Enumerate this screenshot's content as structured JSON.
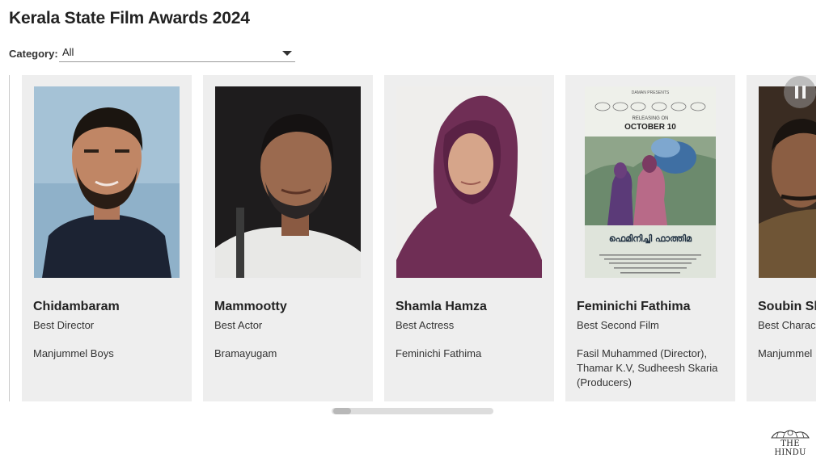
{
  "page": {
    "title": "Kerala State Film Awards 2024"
  },
  "filter": {
    "label": "Category:",
    "selected": "All"
  },
  "awards": [
    {
      "name": "Chidambaram",
      "award": "Best Director",
      "film": "Manjummel Boys"
    },
    {
      "name": "Mammootty",
      "award": "Best Actor",
      "film": "Bramayugam"
    },
    {
      "name": "Shamla Hamza",
      "award": "Best Actress",
      "film": "Feminichi Fathima"
    },
    {
      "name": "Feminichi Fathima",
      "award": "Best Second Film",
      "film": "Fasil Muhammed (Director), Thamar K.V, Sudheesh Skaria (Producers)"
    },
    {
      "name": "Soubin Sh",
      "award": "Best Charac",
      "film": "Manjummel"
    }
  ],
  "poster": {
    "presents": "DAMAN PRESENTS",
    "release_line1": "RELEASING ON",
    "release_line2": "OCTOBER 10",
    "malayalam_title": "ഫെമിനിച്ചി ഫാത്തിമ"
  },
  "logo": {
    "text": "THE HINDU"
  },
  "colors": {
    "card_bg": "#eeeeee",
    "scroll_track": "#dddddd",
    "scroll_thumb": "#b8b8b8"
  },
  "icons": {
    "dropdown": "caret-down-icon",
    "pause": "pause-icon"
  }
}
